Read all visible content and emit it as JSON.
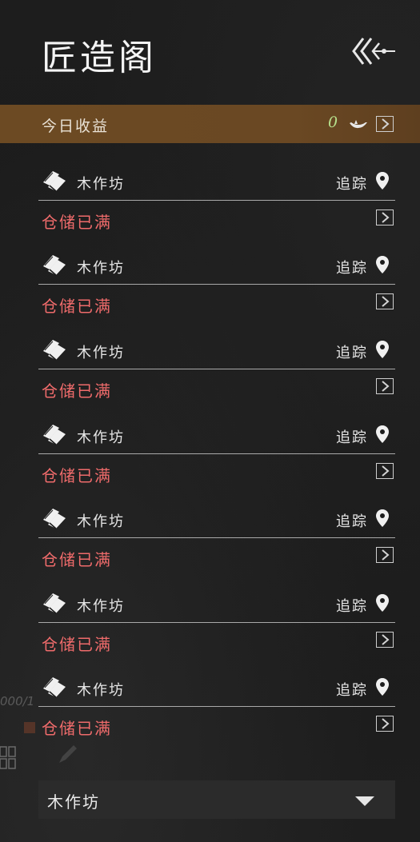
{
  "header": {
    "title": "匠造阁"
  },
  "income": {
    "label": "今日收益",
    "value": "0"
  },
  "items": [
    {
      "name": "木作坊",
      "track_label": "追踪",
      "status": "仓储已满"
    },
    {
      "name": "木作坊",
      "track_label": "追踪",
      "status": "仓储已满"
    },
    {
      "name": "木作坊",
      "track_label": "追踪",
      "status": "仓储已满"
    },
    {
      "name": "木作坊",
      "track_label": "追踪",
      "status": "仓储已满"
    },
    {
      "name": "木作坊",
      "track_label": "追踪",
      "status": "仓储已满"
    },
    {
      "name": "木作坊",
      "track_label": "追踪",
      "status": "仓储已满"
    },
    {
      "name": "木作坊",
      "track_label": "追踪",
      "status": "仓储已满"
    }
  ],
  "background": {
    "counter_text": "000/1"
  },
  "filter": {
    "selected": "木作坊"
  },
  "colors": {
    "income_bar": "#6c4a23",
    "status_full": "#ef6b6b",
    "income_value": "#b6e08c"
  },
  "icons": {
    "back": "back-arrows-icon",
    "currency": "boat-icon",
    "wood": "wood-planks-icon",
    "pin": "location-pin-icon",
    "arrow": "chevron-right-box-icon",
    "caret": "caret-down-icon"
  }
}
